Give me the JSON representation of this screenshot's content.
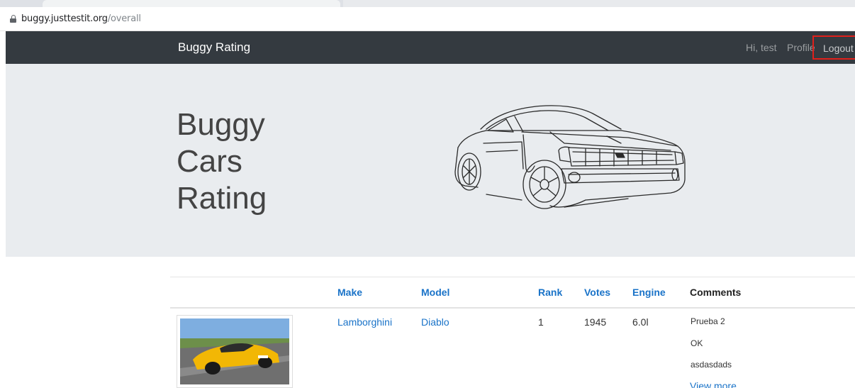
{
  "browser": {
    "url_domain": "buggy.justtestit.org",
    "url_path": "/overall"
  },
  "navbar": {
    "brand": "Buggy Rating",
    "greeting": "Hi, test",
    "profile": "Profile",
    "logout": "Logout",
    "highlight_color": "#e0201b"
  },
  "hero": {
    "title_line1": "Buggy",
    "title_line2": "Cars",
    "title_line3": "Rating"
  },
  "table": {
    "headers": {
      "make": "Make",
      "model": "Model",
      "rank": "Rank",
      "votes": "Votes",
      "engine": "Engine",
      "comments": "Comments"
    },
    "rows": [
      {
        "make": "Lamborghini",
        "model": "Diablo",
        "rank": "1",
        "votes": "1945",
        "engine": "6.0l",
        "comments": [
          "Prueba 2",
          "OK",
          "asdasdads"
        ],
        "view_more": "View more"
      }
    ]
  }
}
